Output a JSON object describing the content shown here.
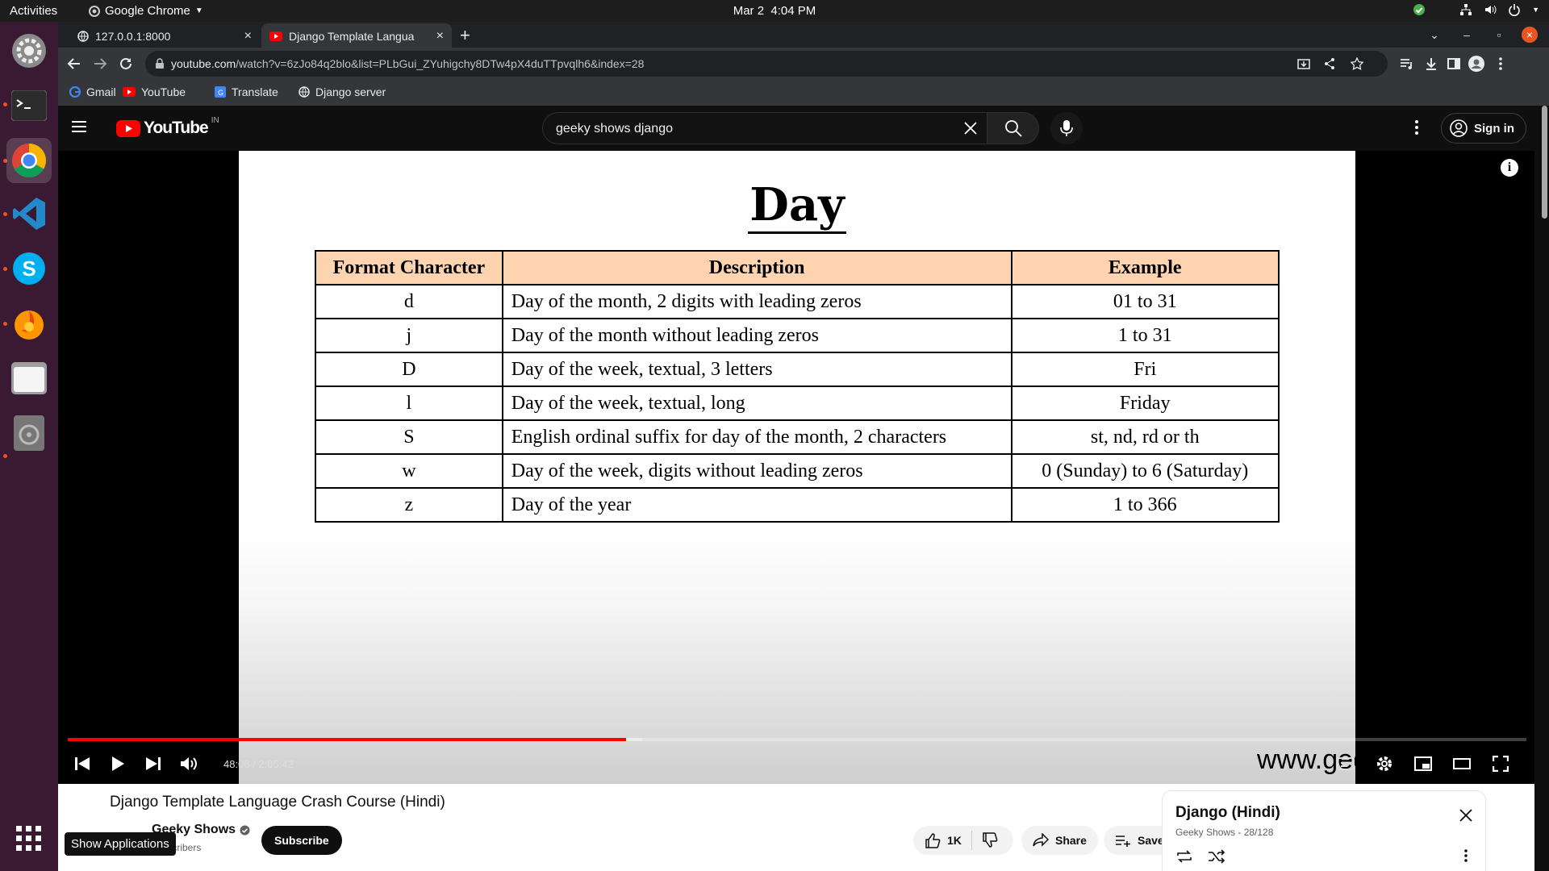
{
  "topbar": {
    "activities": "Activities",
    "app_name": "Google Chrome",
    "date": "Mar 2",
    "time": "4:04 PM"
  },
  "dock": {
    "tooltip": "Show Applications",
    "items": [
      "settings",
      "terminal",
      "google-chrome",
      "vs-code",
      "skype",
      "blender",
      "files",
      "disk-utility"
    ]
  },
  "browser": {
    "tabs": [
      {
        "title": "127.0.0.1:8000"
      },
      {
        "title": "Django Template Langua"
      }
    ],
    "url_host": "youtube.com",
    "url_path": "/watch?v=6zJo84q2blo&list=PLbGui_ZYuhigchy8DTw4pX4duTTpvqlh6&index=28",
    "bookmarks": [
      "Gmail",
      "YouTube",
      "Translate",
      "Django server"
    ]
  },
  "youtube": {
    "logo_text": "YouTube",
    "region": "IN",
    "search_value": "geeky shows django",
    "signin_label": "Sign in",
    "player": {
      "current_time": "48:06",
      "duration": "2:05:42",
      "time_display": "48:06 / 2:05:42",
      "played_fraction": 0.383,
      "buffered_fraction": 0.394
    },
    "slide": {
      "title": "Day",
      "headers": [
        "Format Character",
        "Description",
        "Example"
      ],
      "rows": [
        [
          "d",
          "Day of the month, 2 digits with leading zeros",
          "01 to 31"
        ],
        [
          "j",
          "Day of the month without leading zeros",
          "1 to 31"
        ],
        [
          "D",
          "Day of the week, textual, 3 letters",
          "Fri"
        ],
        [
          "l",
          "Day of the week, textual, long",
          "Friday"
        ],
        [
          "S",
          "English ordinal suffix for day of the month, 2 characters",
          "st, nd, rd or th"
        ],
        [
          "w",
          "Day of the week, digits without leading zeros",
          "0 (Sunday) to 6 (Saturday)"
        ],
        [
          "z",
          "Day of the year",
          "1 to 366"
        ]
      ],
      "watermark": "www.geekyshows.com"
    },
    "video_title": "Django Template Language Crash Course (Hindi)",
    "channel_name": "Geeky Shows",
    "subscribers_text": "subscribers",
    "subscribe_label": "Subscribe",
    "like_count": "1K",
    "share_label": "Share",
    "save_label": "Save",
    "playlist": {
      "title": "Django (Hindi)",
      "subtitle": "Geeky Shows - 28/128"
    }
  },
  "colors": {
    "accent_red": "#ff0000",
    "table_header": "#fdd3b0",
    "dock_bg": "#3a1a32",
    "ubuntu_orange": "#e95420"
  }
}
